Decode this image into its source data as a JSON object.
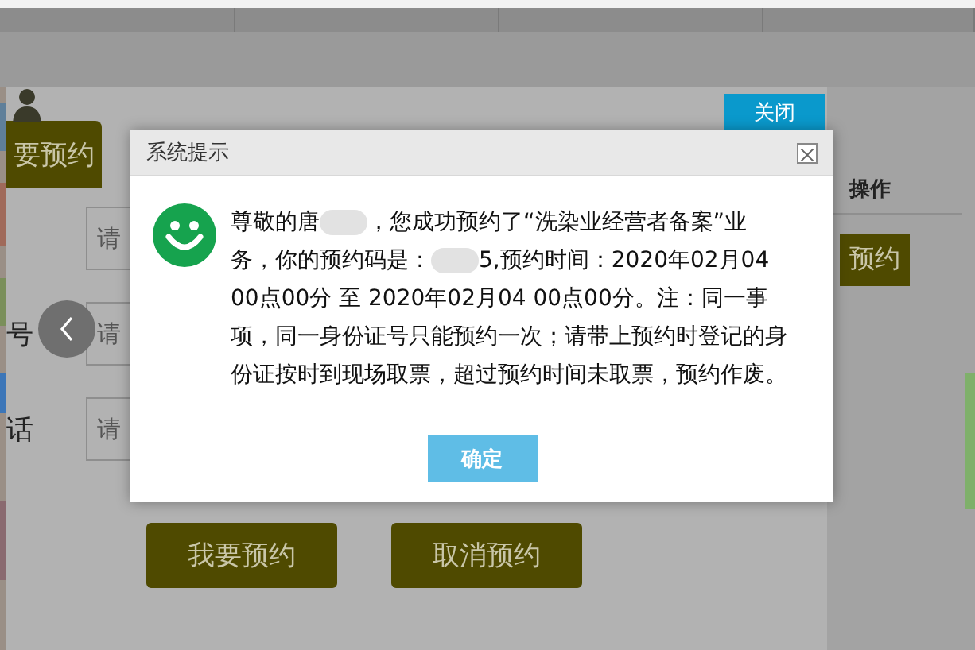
{
  "tab": {
    "label": "要预约"
  },
  "form": {
    "fields": [
      {
        "placeholder": "请"
      },
      {
        "label": "号",
        "placeholder": "请"
      },
      {
        "label": "话",
        "placeholder": "请"
      }
    ]
  },
  "buttons": [
    "我要预约",
    "取消预约"
  ],
  "table": {
    "columns": [
      "操作"
    ],
    "row_button": "预约"
  },
  "close_button": "关闭",
  "dialog": {
    "title": "系统提示",
    "message": [
      {
        "kind": "text",
        "text": "尊敬的唐"
      },
      {
        "kind": "redacted"
      },
      {
        "kind": "text",
        "text": "，您成功预约了“洗染业经营者备案”业务，你的预约码是："
      },
      {
        "kind": "redacted"
      },
      {
        "kind": "text",
        "text": "5,预约时间：2020年02月04 00点00分 至 2020年02月04 00点00分。注：同一事项，同一身份证号只能预约一次；请带上预约时登记的身份证按时到现场取票，超过预约时间未取票，预约作废。"
      }
    ],
    "confirm": "确定"
  }
}
